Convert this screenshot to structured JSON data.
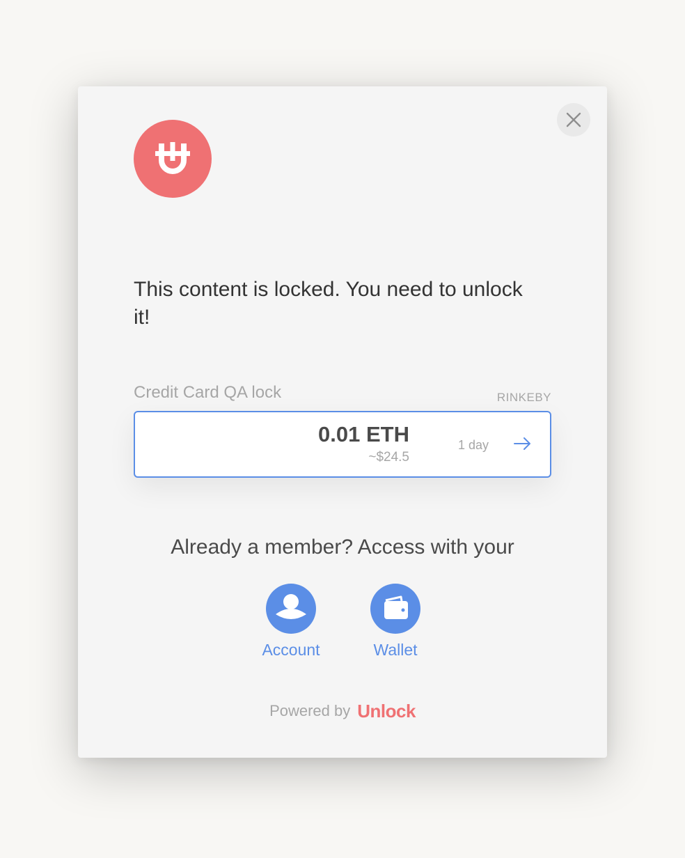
{
  "modal": {
    "close_icon": "close-icon",
    "logo_icon": "unlock-logo-icon",
    "message": "This content is locked. You need to unlock it!"
  },
  "lock": {
    "name": "Credit Card QA lock",
    "network": "RINKEBY",
    "price": "0.01 ETH",
    "price_usd": "~$24.5",
    "duration": "1 day",
    "action_icon": "arrow-right-icon"
  },
  "member": {
    "prompt": "Already a member? Access with your",
    "options": [
      {
        "label": "Account",
        "icon": "user-icon"
      },
      {
        "label": "Wallet",
        "icon": "wallet-icon"
      }
    ]
  },
  "footer": {
    "powered_by": "Powered by",
    "brand": "Unlock"
  },
  "colors": {
    "brand": "#ef7173",
    "accent": "#5b8ee6",
    "text": "#333333",
    "muted": "#a6a6a6",
    "background": "#f8f7f4",
    "modal": "#f5f5f5"
  }
}
